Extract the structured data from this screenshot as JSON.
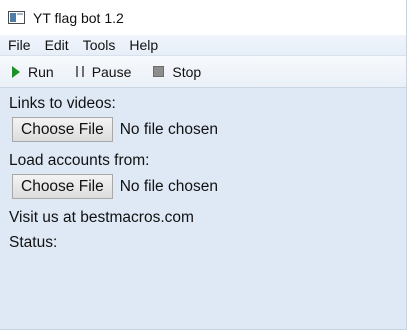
{
  "window": {
    "title": "YT flag bot 1.2"
  },
  "menu": {
    "items": [
      "File",
      "Edit",
      "Tools",
      "Help"
    ]
  },
  "toolbar": {
    "run_label": "Run",
    "pause_label": "Pause",
    "stop_label": "Stop"
  },
  "form": {
    "links_label": "Links to videos:",
    "links_button": "Choose File",
    "links_status": "No file chosen",
    "accounts_label": "Load accounts from:",
    "accounts_button": "Choose File",
    "accounts_status": "No file chosen",
    "visit_text": "Visit us at bestmacros.com",
    "status_label": "Status:"
  },
  "icons": {
    "app": "app-window-icon",
    "run": "play-icon",
    "pause": "pause-icon",
    "stop": "stop-icon"
  },
  "colors": {
    "background": "#dfe9f6",
    "run_icon": "#1f8f2a"
  }
}
